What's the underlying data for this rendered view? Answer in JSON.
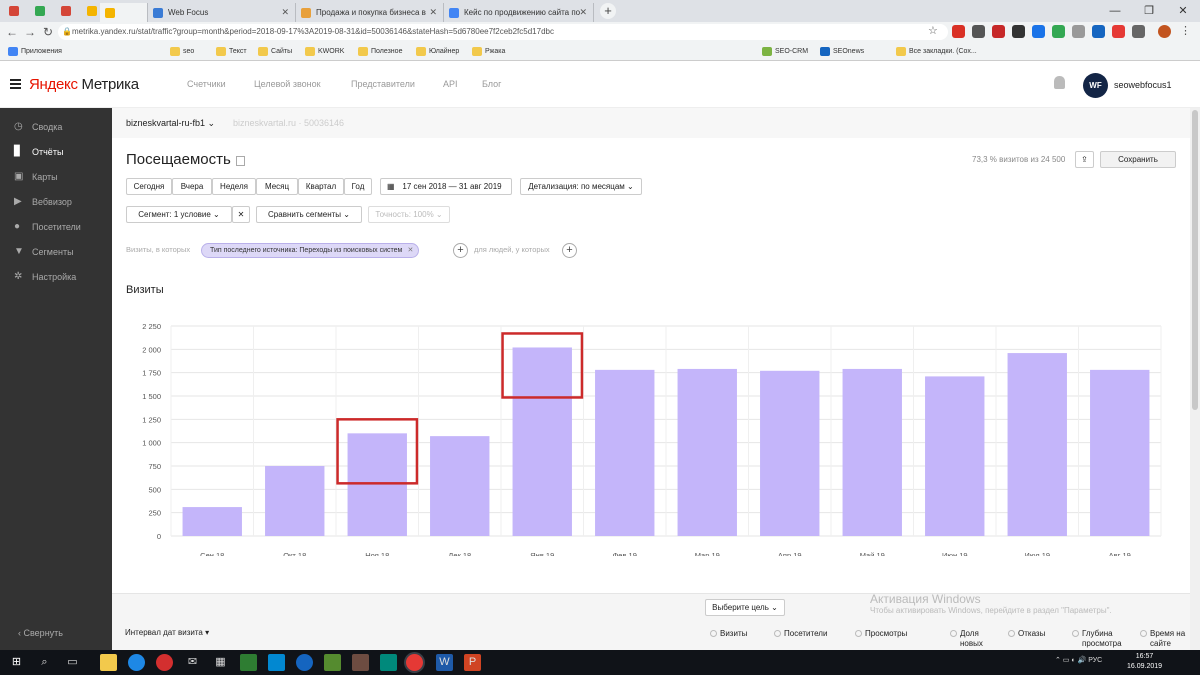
{
  "browser": {
    "tabs": [
      {
        "label": "Web Focus",
        "color": "#3a7bd5"
      },
      {
        "label": "Продажа и покупка бизнеса в",
        "color": "#e8a03b"
      },
      {
        "label": "Кейс по продвижению сайта по",
        "color": "#4285f4"
      }
    ],
    "pinned_colors": [
      "#d44638",
      "#34a853",
      "#d44638",
      "#f4b400",
      "#f4b400"
    ],
    "url": "metrika.yandex.ru/stat/traffic?group=month&period=2018-09-17%3A2019-08-31&id=50036146&stateHash=5d6780ee7f2ceb2fc5d17dbc",
    "bookmarks": [
      "Приложения",
      "seo",
      "Текст",
      "Сайты",
      "KWORK",
      "Полезное",
      "Юлайнер",
      "Ржака",
      "SEO-CRM",
      "SEOnews",
      "Все закладки. (Сох..."
    ]
  },
  "header": {
    "logo_left": "Яндекс",
    "logo_right": " Метрика",
    "nav": [
      "Счетчики",
      "Целевой звонок",
      "Представители",
      "API",
      "Блог"
    ],
    "avatar_text": "WF",
    "username": "seowebfocus1"
  },
  "sidebar": {
    "items": [
      {
        "label": "Сводка",
        "icon": "◷",
        "active": false
      },
      {
        "label": "Отчёты",
        "icon": "▊",
        "active": true
      },
      {
        "label": "Карты",
        "icon": "▣",
        "active": false
      },
      {
        "label": "Вебвизор",
        "icon": "▶",
        "active": false
      },
      {
        "label": "Посетители",
        "icon": "●",
        "active": false
      },
      {
        "label": "Сегменты",
        "icon": "▼",
        "active": false
      },
      {
        "label": "Настройка",
        "icon": "✲",
        "active": false
      }
    ],
    "collapse": "‹  Свернуть"
  },
  "counter": {
    "name": "bizneskvartal-ru-fb1 ⌄",
    "sub": "bizneskvartal.ru · 50036146"
  },
  "report": {
    "title": "Посещаемость",
    "visits_info": "73,3 % визитов из 24 500",
    "save": "Сохранить",
    "periods": [
      "Сегодня",
      "Вчера",
      "Неделя",
      "Месяц",
      "Квартал",
      "Год"
    ],
    "date_range": "17 сен 2018 — 31 авг 2019",
    "detail": "Детализация: по месяцам ⌄",
    "segment": "Сегмент: 1 условие ⌄",
    "compare": "Сравнить сегменты ⌄",
    "accuracy": "Точность: 100% ⌄",
    "filter_prefix": "Визиты, в которых",
    "filter_chip": "Тип последнего источника: Переходы из поисковых систем",
    "for_people": "для людей, у которых"
  },
  "chart_data": {
    "type": "bar",
    "title": "Визиты",
    "categories": [
      "Сен 18",
      "Окт 18",
      "Ноя 18",
      "Дек 18",
      "Янв 19",
      "Фев 19",
      "Мар 19",
      "Апр 19",
      "Май 19",
      "Июн 19",
      "Июл 19",
      "Авг 19"
    ],
    "values": [
      310,
      750,
      1100,
      1070,
      2020,
      1780,
      1790,
      1770,
      1790,
      1710,
      1960,
      1780
    ],
    "yticks": [
      0,
      250,
      500,
      750,
      1000,
      1250,
      1500,
      1750,
      2000,
      2250
    ],
    "ytick_labels": [
      "0",
      "250",
      "500",
      "750",
      "1 000",
      "1 250",
      "1 500",
      "1 750",
      "2 000",
      "2 250"
    ],
    "ylim": [
      0,
      2250
    ],
    "bar_color": "#c4b5fa",
    "highlight_color": "#cc2a2a",
    "highlighted_categories": [
      "Ноя 18",
      "Янв 19"
    ],
    "grid": true
  },
  "bottom": {
    "goal": "Выберите цель ⌄",
    "interval": "Интервал дат визита ▾",
    "metrics": [
      "Визиты",
      "Посетители",
      "Просмотры",
      "Доля новых",
      "Отказы",
      "Глубина просмотра",
      "Время на сайте"
    ]
  },
  "overlay": {
    "activation_title": "Активация Windows",
    "activation_text": "Чтобы активировать Windows, перейдите в раздел \"Параметры\"."
  },
  "taskbar": {
    "lang": "РУС",
    "time": "16:57",
    "date": "16.09.2019"
  }
}
